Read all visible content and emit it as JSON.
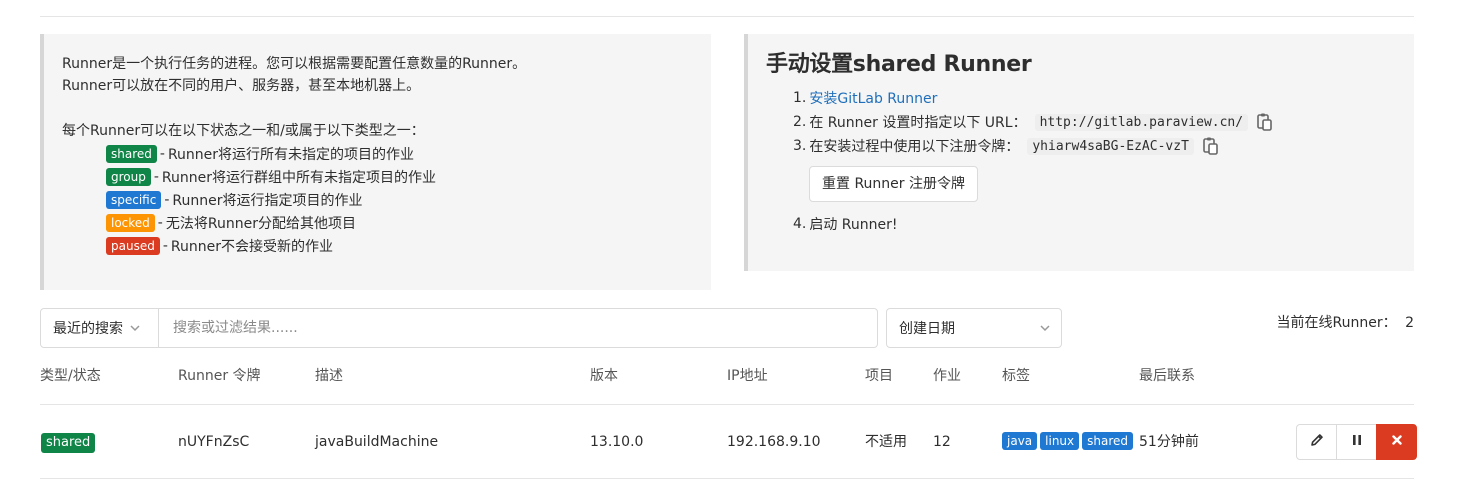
{
  "info": {
    "intro_line1": "Runner是一个执行任务的进程。您可以根据需要配置任意数量的Runner。",
    "intro_line2": "Runner可以放在不同的用户、服务器，甚至本地机器上。",
    "status_intro": "每个Runner可以在以下状态之一和/或属于以下类型之一：",
    "badges": [
      {
        "label": "shared",
        "desc": "Runner将运行所有未指定的项目的作业",
        "color": "#108548"
      },
      {
        "label": "group",
        "desc": "Runner将运行群组中所有未指定项目的作业",
        "color": "#108548"
      },
      {
        "label": "specific",
        "desc": "Runner将运行指定项目的作业",
        "color": "#1f78d1"
      },
      {
        "label": "locked",
        "desc": "无法将Runner分配给其他项目",
        "color": "#fc9403"
      },
      {
        "label": "paused",
        "desc": "Runner不会接受新的作业",
        "color": "#db3b21"
      }
    ],
    "separator": "-"
  },
  "setup": {
    "title": "手动设置shared Runner",
    "step1_num": "1.",
    "step1_link": "安装GitLab Runner",
    "step2_num": "2.",
    "step2_text": "在 Runner 设置时指定以下 URL：",
    "step2_code": "http://gitlab.paraview.cn/",
    "step3_num": "3.",
    "step3_text": "在安装过程中使用以下注册令牌：",
    "step3_code": "yhiarw4saBG-EzAC-vzT",
    "reset_button": "重置 Runner 注册令牌",
    "step4_num": "4.",
    "step4_text": "启动 Runner!"
  },
  "filter": {
    "recent_label": "最近的搜索",
    "search_placeholder": "搜索或过滤结果......",
    "sort_label": "创建日期",
    "online_label": "当前在线Runner：",
    "online_count": "2"
  },
  "table": {
    "headers": [
      "类型/状态",
      "Runner 令牌",
      "描述",
      "版本",
      "IP地址",
      "项目",
      "作业",
      "标签",
      "最后联系"
    ],
    "rows": [
      {
        "type": "shared",
        "token": "nUYFnZsC",
        "description": "javaBuildMachine",
        "version": "13.10.0",
        "ip": "192.168.9.10",
        "projects": "不适用",
        "jobs": "12",
        "tags": [
          "java",
          "linux",
          "shared"
        ],
        "last_contact": "51分钟前"
      }
    ]
  },
  "colors": {
    "shared_badge": "#108548",
    "tag_blue": "#1f78d1",
    "link": "#1f6fba",
    "danger": "#db3b21"
  },
  "icons": {
    "copy": "clipboard-icon",
    "chevron": "chevron-down-icon",
    "edit": "pencil-icon",
    "pause": "pause-icon",
    "remove": "close-icon"
  }
}
